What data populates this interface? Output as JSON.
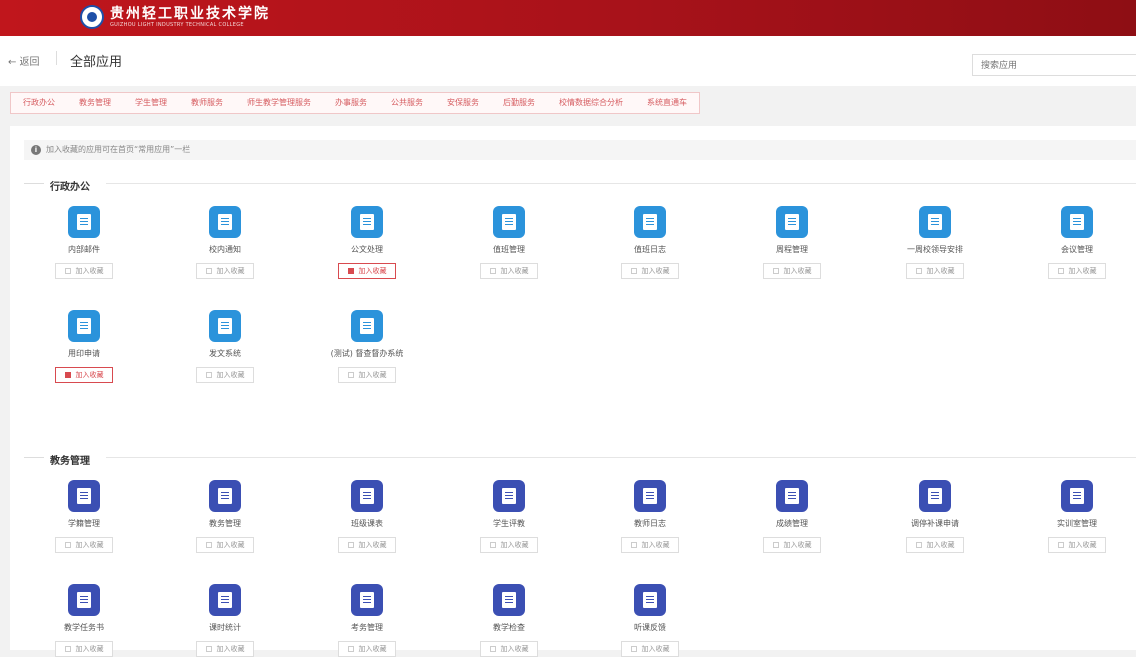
{
  "header": {
    "school_name_cn": "贵州轻工职业技术学院",
    "school_name_en": "GUIZHOU LIGHT INDUSTRY TECHNICAL COLLEGE"
  },
  "nav": {
    "back_label": "← 返回",
    "page_title": "全部应用",
    "search_placeholder": "搜索应用"
  },
  "tabs": [
    "行政办公",
    "教务管理",
    "学生管理",
    "教师服务",
    "师生教学管理服务",
    "办事服务",
    "公共服务",
    "安保服务",
    "后勤服务",
    "校情数据综合分析",
    "系统直通车"
  ],
  "notice": "加入收藏的应用可在首页“常用应用”一栏",
  "fav_label": "加入收藏",
  "sections": [
    {
      "title": "行政办公",
      "apps": [
        {
          "name": "内部邮件",
          "favorited": false
        },
        {
          "name": "校内通知",
          "favorited": false
        },
        {
          "name": "公文处理",
          "favorited": true
        },
        {
          "name": "值班管理",
          "favorited": false
        },
        {
          "name": "值班日志",
          "favorited": false
        },
        {
          "name": "周程管理",
          "favorited": false
        },
        {
          "name": "一周校领导安排",
          "favorited": false
        },
        {
          "name": "会议管理",
          "favorited": false
        },
        {
          "name": "用印申请",
          "favorited": true
        },
        {
          "name": "发文系统",
          "favorited": false
        },
        {
          "name": "(测试) 督查督办系统",
          "favorited": false
        }
      ]
    },
    {
      "title": "教务管理",
      "apps": [
        {
          "name": "学籍管理",
          "favorited": false
        },
        {
          "name": "教务管理",
          "favorited": false
        },
        {
          "name": "班级课表",
          "favorited": false
        },
        {
          "name": "学生评教",
          "favorited": false
        },
        {
          "name": "教师日志",
          "favorited": false
        },
        {
          "name": "成绩管理",
          "favorited": false
        },
        {
          "name": "调停补课申请",
          "favorited": false
        },
        {
          "name": "实训室管理",
          "favorited": false
        },
        {
          "name": "教学任务书",
          "favorited": false
        },
        {
          "name": "课时统计",
          "favorited": false
        },
        {
          "name": "考务管理",
          "favorited": false
        },
        {
          "name": "教学检查",
          "favorited": false
        },
        {
          "name": "听课反馈",
          "favorited": false
        }
      ]
    }
  ],
  "colors": {
    "header_red": "#c0161c",
    "icon_blue": "#2b93db",
    "icon_indigo": "#3b4fb3",
    "fav_active": "#d84a4f"
  }
}
